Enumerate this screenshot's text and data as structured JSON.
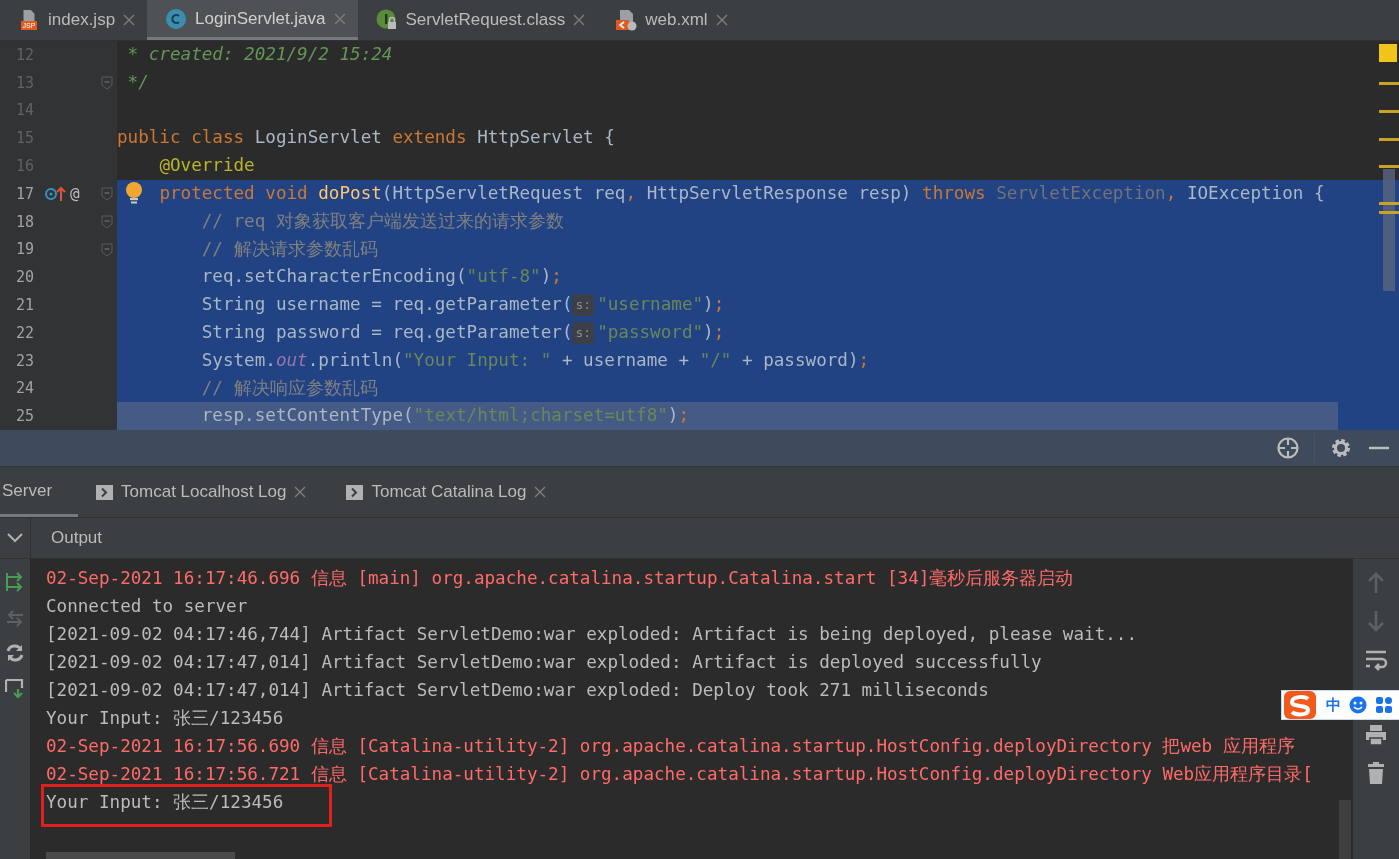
{
  "editor_tabs": [
    {
      "label": "index.jsp",
      "kind": "jsp",
      "badge": "JSP",
      "selected": false
    },
    {
      "label": "LoginServlet.java",
      "kind": "class",
      "selected": true
    },
    {
      "label": "ServletRequest.class",
      "kind": "interface",
      "selected": false
    },
    {
      "label": "web.xml",
      "kind": "xml",
      "selected": false
    }
  ],
  "editor": {
    "lines": [
      {
        "number": "12",
        "selected": false,
        "fold": false,
        "tokens": [
          {
            "kind": "doc",
            "text": " * created: 2021/9/2 15:24"
          }
        ]
      },
      {
        "number": "13",
        "selected": false,
        "fold": true,
        "tokens": [
          {
            "kind": "doc",
            "text": " */"
          }
        ]
      },
      {
        "number": "14",
        "selected": false,
        "fold": false
      },
      {
        "number": "15",
        "selected": false,
        "fold": false,
        "tokens": [
          {
            "kind": "keyword",
            "text": "public class "
          },
          {
            "kind": "plain",
            "text": "LoginServlet "
          },
          {
            "kind": "keyword",
            "text": "extends "
          },
          {
            "kind": "plain",
            "text": "HttpServlet {"
          }
        ]
      },
      {
        "number": "16",
        "selected": false,
        "fold": false,
        "tokens": [
          {
            "kind": "annotation",
            "text": "    @Override"
          }
        ]
      },
      {
        "number": "17",
        "selected": true,
        "fold": true,
        "bulb": true,
        "markers": [
          {
            "kind": "override"
          },
          {
            "kind": "glyph",
            "text": "@"
          }
        ],
        "tokens": [
          {
            "kind": "keyword",
            "text": "    protected void "
          },
          {
            "kind": "method",
            "text": "doPost"
          },
          {
            "kind": "plain",
            "text": "(HttpServletRequest req"
          },
          {
            "kind": "keyword",
            "text": ", "
          },
          {
            "kind": "plain",
            "text": "HttpServletResponse resp) "
          },
          {
            "kind": "keyword",
            "text": "throws "
          },
          {
            "kind": "dim",
            "text": "ServletException"
          },
          {
            "kind": "keyword",
            "text": ", "
          },
          {
            "kind": "plain",
            "text": "IOException {"
          }
        ]
      },
      {
        "number": "18",
        "selected": true,
        "fold": true,
        "tokens": [
          {
            "kind": "comment",
            "text": "        // req 对象获取客户端发送过来的请求参数"
          }
        ]
      },
      {
        "number": "19",
        "selected": true,
        "fold": true,
        "tokens": [
          {
            "kind": "comment",
            "text": "        // 解决请求参数乱码"
          }
        ]
      },
      {
        "number": "20",
        "selected": true,
        "fold": false,
        "tokens": [
          {
            "kind": "plain",
            "text": "        req.setCharacterEncoding("
          },
          {
            "kind": "string",
            "text": "\"utf-8\""
          },
          {
            "kind": "plain",
            "text": ")"
          },
          {
            "kind": "keyword",
            "text": ";"
          }
        ]
      },
      {
        "number": "21",
        "selected": true,
        "fold": false,
        "tokens": [
          {
            "kind": "plain",
            "text": "        String username = req.getParameter("
          },
          {
            "kind": "hint",
            "text": "s:"
          },
          {
            "kind": "string",
            "text": "\"username\""
          },
          {
            "kind": "plain",
            "text": ")"
          },
          {
            "kind": "keyword",
            "text": ";"
          }
        ]
      },
      {
        "number": "22",
        "selected": true,
        "fold": false,
        "tokens": [
          {
            "kind": "plain",
            "text": "        String password = req.getParameter("
          },
          {
            "kind": "hint",
            "text": "s:"
          },
          {
            "kind": "string",
            "text": "\"password\""
          },
          {
            "kind": "plain",
            "text": ")"
          },
          {
            "kind": "keyword",
            "text": ";"
          }
        ]
      },
      {
        "number": "23",
        "selected": true,
        "fold": false,
        "tokens": [
          {
            "kind": "plain",
            "text": "        System."
          },
          {
            "kind": "static",
            "text": "out"
          },
          {
            "kind": "plain",
            "text": ".println("
          },
          {
            "kind": "string",
            "text": "\"Your Input: \""
          },
          {
            "kind": "plain",
            "text": " + username + "
          },
          {
            "kind": "string",
            "text": "\"/\""
          },
          {
            "kind": "plain",
            "text": " + password)"
          },
          {
            "kind": "keyword",
            "text": ";"
          }
        ]
      },
      {
        "number": "24",
        "selected": true,
        "fold": false,
        "tokens": [
          {
            "kind": "comment",
            "text": "        // 解决响应参数乱码"
          }
        ]
      },
      {
        "number": "25",
        "selected": true,
        "current": true,
        "fold": false,
        "tokens": [
          {
            "kind": "plain",
            "text": "        resp.setContentType("
          },
          {
            "kind": "string",
            "text": "\"text/html;charset=utf8\""
          },
          {
            "kind": "plain",
            "text": ")"
          },
          {
            "kind": "keyword",
            "text": ";"
          }
        ]
      }
    ]
  },
  "tool_tabs": [
    {
      "label": "Server",
      "closable": false,
      "selected": true
    },
    {
      "label": "Tomcat Localhost Log",
      "closable": true,
      "selected": false
    },
    {
      "label": "Tomcat Catalina Log",
      "closable": true,
      "selected": false
    }
  ],
  "output_header": {
    "label": "Output"
  },
  "console": {
    "lines": [
      {
        "kind": "error",
        "text": "02-Sep-2021 16:17:46.696 信息 [main] org.apache.catalina.startup.Catalina.start [34]毫秒后服务器启动",
        "highlighted": false
      },
      {
        "kind": "normal",
        "text": "Connected to server",
        "highlighted": false
      },
      {
        "kind": "normal",
        "text": "[2021-09-02 04:17:46,744] Artifact ServletDemo:war exploded: Artifact is being deployed, please wait...",
        "highlighted": false
      },
      {
        "kind": "normal",
        "text": "[2021-09-02 04:17:47,014] Artifact ServletDemo:war exploded: Artifact is deployed successfully",
        "highlighted": false
      },
      {
        "kind": "normal",
        "text": "[2021-09-02 04:17:47,014] Artifact ServletDemo:war exploded: Deploy took 271 milliseconds",
        "highlighted": false
      },
      {
        "kind": "normal",
        "text": "Your Input: 张三/123456",
        "highlighted": false
      },
      {
        "kind": "error",
        "text": "02-Sep-2021 16:17:56.690 信息 [Catalina-utility-2] org.apache.catalina.startup.HostConfig.deployDirectory 把web 应用程序",
        "highlighted": false
      },
      {
        "kind": "error",
        "text": "02-Sep-2021 16:17:56.721 信息 [Catalina-utility-2] org.apache.catalina.startup.HostConfig.deployDirectory Web应用程序目录[",
        "highlighted": false
      },
      {
        "kind": "normal",
        "text": "Your Input: 张三/123456",
        "highlighted": true
      }
    ]
  },
  "ime_bar": {
    "label": "中"
  }
}
